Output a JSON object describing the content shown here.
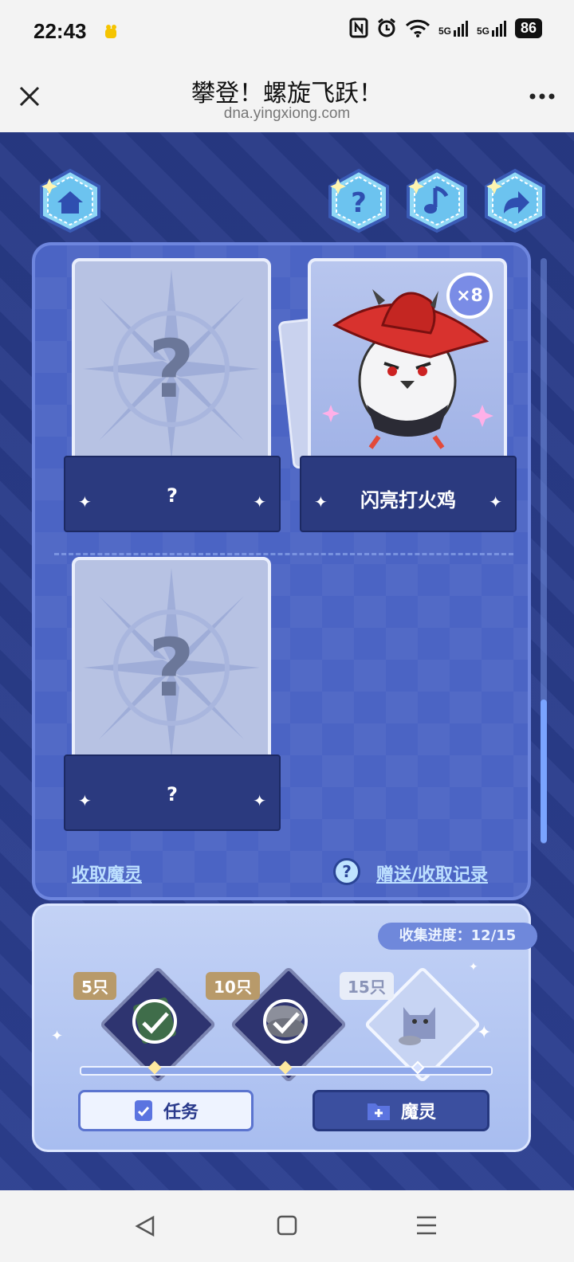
{
  "status": {
    "time": "22:43",
    "battery": "86",
    "network1": "5G",
    "network2": "5G"
  },
  "nav": {
    "title": "攀登！螺旋飞跃！",
    "url": "dna.yingxiong.com"
  },
  "icons": {
    "home": "home-icon",
    "help": "question-icon",
    "music": "music-icon",
    "share": "share-icon"
  },
  "cards": [
    {
      "name": "?",
      "revealed": false
    },
    {
      "name": "闪亮打火鸡",
      "revealed": true,
      "count": "×8"
    },
    {
      "name": "?",
      "revealed": false
    }
  ],
  "links": {
    "receive": "收取魔灵",
    "records": "赠送/收取记录",
    "records_icon": "?"
  },
  "progress": {
    "label": "收集进度：",
    "value": "12/15"
  },
  "milestones": [
    {
      "label": "5只",
      "completed": true
    },
    {
      "label": "10只",
      "completed": true
    },
    {
      "label": "15只",
      "completed": false
    }
  ],
  "buttons": {
    "task": "任务",
    "spirit": "魔灵"
  },
  "colors": {
    "accent": "#4b64c4",
    "dark": "#2b3a7f",
    "link": "#bde0ff"
  }
}
